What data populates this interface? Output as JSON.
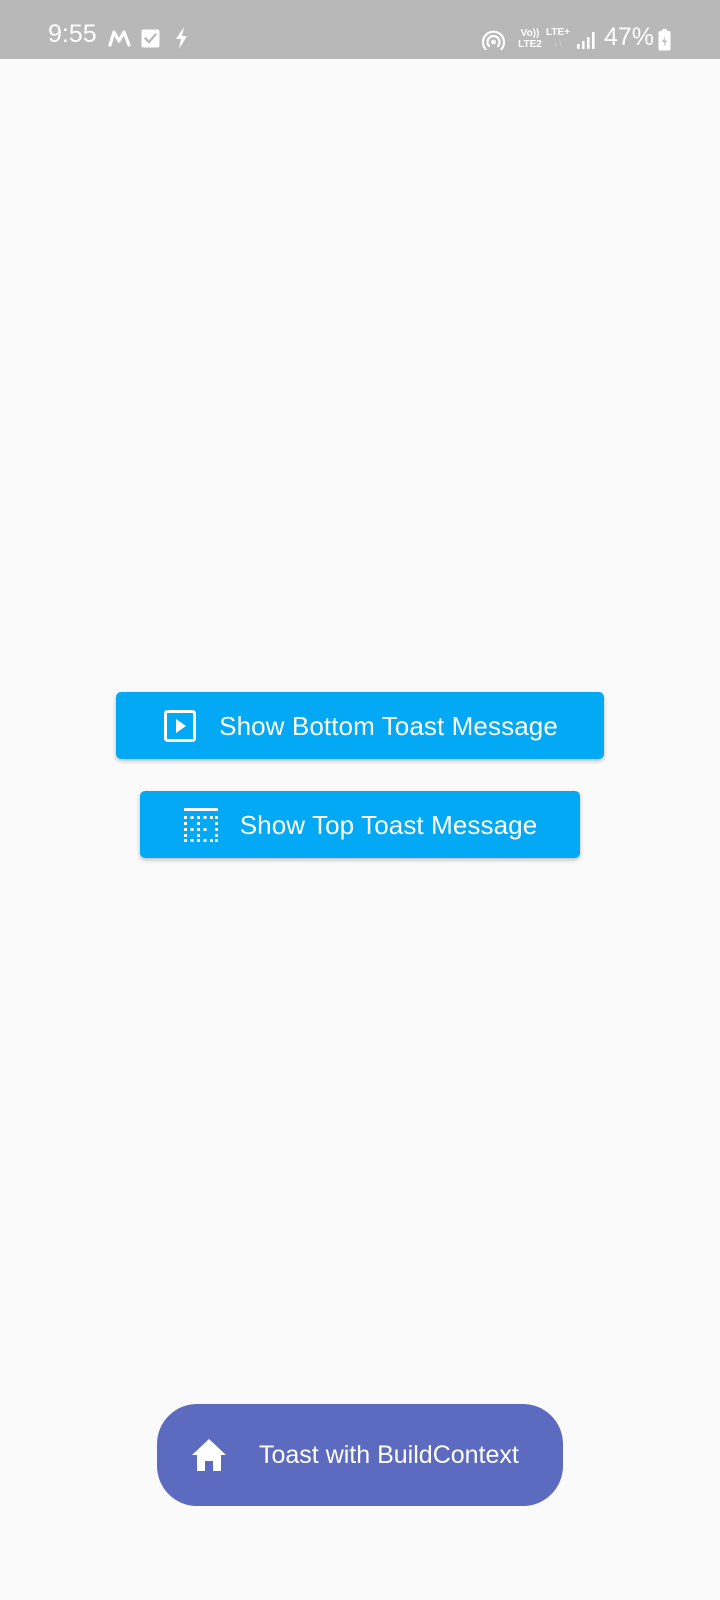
{
  "status_bar": {
    "time": "9:55",
    "volte_line1": "Vo))",
    "volte_line2": "LTE2",
    "lte_label": "LTE+",
    "lte_arrows": "↓↑",
    "battery_percent": "47%",
    "icons": [
      "m-app-icon",
      "check-box-icon",
      "bolt-icon",
      "hotspot-icon",
      "signal-icon",
      "battery-charging-icon"
    ]
  },
  "buttons": {
    "bottom_toast": {
      "label": "Show Bottom Toast Message",
      "icon": "play-square-icon"
    },
    "top_toast": {
      "label": "Show Top Toast Message",
      "icon": "border-top-grid-icon"
    }
  },
  "toast": {
    "text": "Toast with BuildContext",
    "icon": "home-icon"
  },
  "colors": {
    "status_bar_bg": "#b8b8b8",
    "background": "#fafafa",
    "button_bg": "#03a9f4",
    "toast_bg": "#5c6bc0",
    "text_on_color": "#ffffff"
  }
}
